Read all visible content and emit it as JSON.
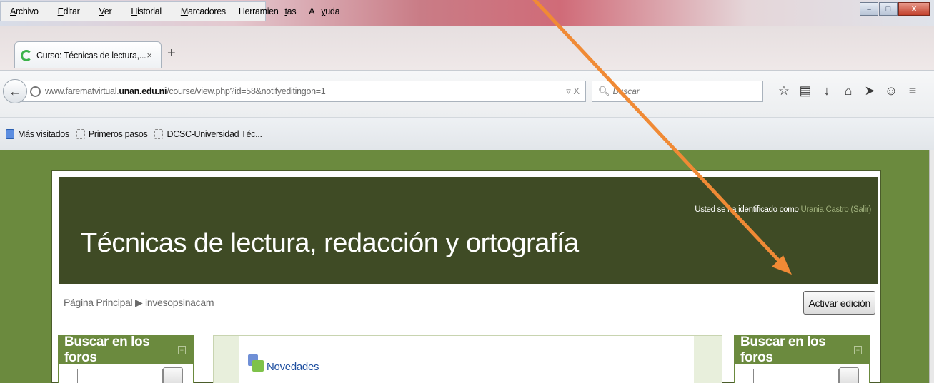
{
  "menu": {
    "items": [
      {
        "pre": "",
        "u": "A",
        "post": "rchivo"
      },
      {
        "pre": "",
        "u": "E",
        "post": "ditar"
      },
      {
        "pre": "",
        "u": "V",
        "post": "er"
      },
      {
        "pre": "",
        "u": "H",
        "post": "istorial"
      },
      {
        "pre": "",
        "u": "M",
        "post": "arcadores"
      },
      {
        "pre": "Herramien",
        "u": "t",
        "post": "as"
      },
      {
        "pre": "A",
        "u": "y",
        "post": "uda"
      }
    ]
  },
  "window": {
    "minimize": "–",
    "maximize": "□",
    "close": "X"
  },
  "tab": {
    "title": "Curso: Técnicas de lectura,...",
    "close": "×",
    "new_tab": "+"
  },
  "nav": {
    "url_host_pre": "www.farematvirtual.",
    "url_host_bold": "unan.edu.ni",
    "url_path": "/course/view.php?id=58&notifyeditingon=1",
    "url_actions": "▿ X",
    "search_placeholder": "Buscar"
  },
  "bookmarks": [
    {
      "label": "Más visitados",
      "icon": "most-visited-icon"
    },
    {
      "label": "Primeros pasos",
      "icon": "page-icon"
    },
    {
      "label": "DCSC-Universidad Téc...",
      "icon": "page-icon"
    }
  ],
  "page": {
    "course_title": "Técnicas de lectura, redacción y ortografía",
    "login_prefix": "Usted se ha identificado como ",
    "user_name": "Urania Castro",
    "logout": "(Salir)",
    "breadcrumb_home": "Página Principal",
    "breadcrumb_sep": "▶",
    "breadcrumb_current": "invesopsinacam",
    "edit_button": "Activar edición",
    "left_block_title": "Buscar en los foros",
    "right_block_title": "Buscar en los foros",
    "news_label": "Novedades"
  },
  "colors": {
    "page_background": "#6b8a3e",
    "header_background": "#3f4b25",
    "arrow": "#f08a35",
    "link": "#1e4fa0"
  }
}
